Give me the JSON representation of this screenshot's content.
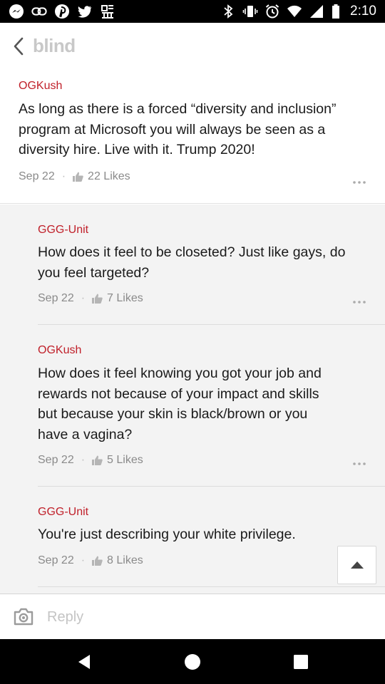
{
  "status_bar": {
    "time": "2:10",
    "left_icons": [
      "messenger-icon",
      "link-icon",
      "pinterest-icon",
      "twitter-icon",
      "app-icon"
    ],
    "right_icons": [
      "bluetooth-icon",
      "vibrate-icon",
      "alarm-icon",
      "wifi-icon",
      "signal-icon",
      "battery-icon"
    ]
  },
  "header": {
    "back_icon": "chevron-left-icon",
    "brand": "blind"
  },
  "top_comment": {
    "author": "OGKush",
    "text": "As long as there is a forced “diversity and inclusion” program at Microsoft you will always be seen as a diversity hire. Live with it. Trump 2020!",
    "date": "Sep 22",
    "likes": "22 Likes"
  },
  "replies": [
    {
      "author": "GGG-Unit",
      "text": "How does it feel to be closeted? Just like gays, do you feel targeted?",
      "date": "Sep 22",
      "likes": "7 Likes"
    },
    {
      "author": "OGKush",
      "text": "How does it feel knowing you got your job and rewards not because of your impact and skills but because your skin is black/brown or you have a vagina?",
      "date": "Sep 22",
      "likes": "5 Likes"
    },
    {
      "author": "GGG-Unit",
      "text": "You're just describing your white privilege.",
      "date": "Sep 22",
      "likes": "8 Likes"
    }
  ],
  "reply_bar": {
    "placeholder": "Reply",
    "camera_icon": "camera-icon"
  },
  "colors": {
    "author": "#c0202a",
    "meta": "#8a8a8a",
    "reply_bg": "#f3f3f3",
    "brand": "#c8c8c8"
  }
}
